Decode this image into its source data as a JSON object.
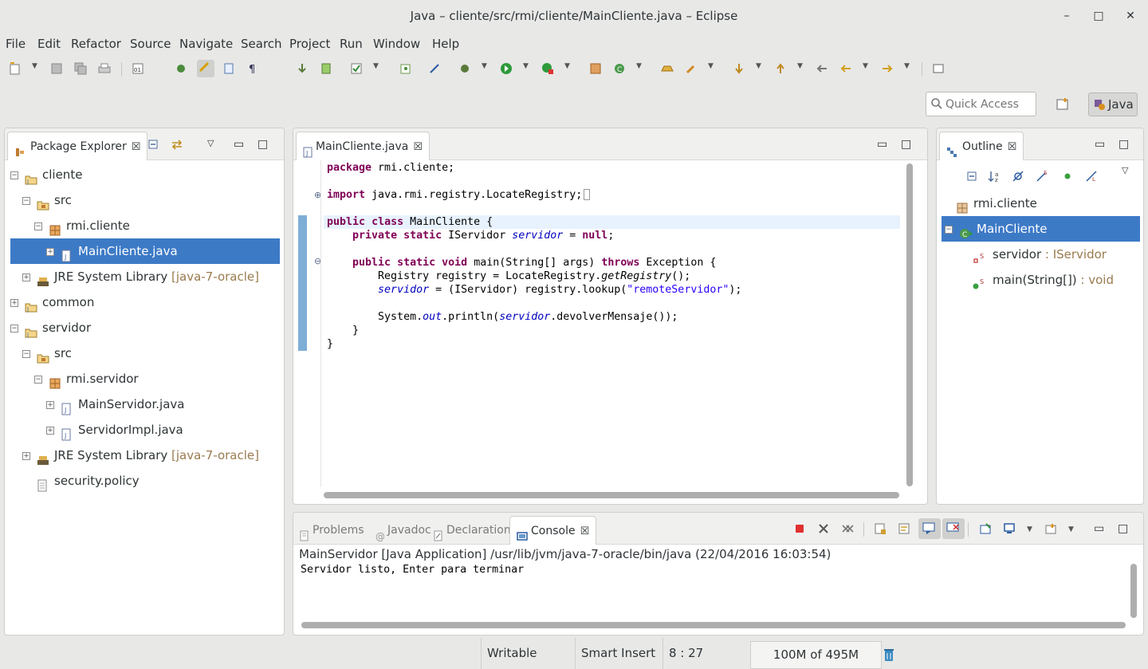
{
  "window": {
    "title": "Java – cliente/src/rmi/cliente/MainCliente.java – Eclipse",
    "minimize": "–",
    "maximize": "□",
    "close": "✕"
  },
  "menu": [
    "File",
    "Edit",
    "Refactor",
    "Source",
    "Navigate",
    "Search",
    "Project",
    "Run",
    "Window",
    "Help"
  ],
  "quick_access": {
    "placeholder": "Quick Access"
  },
  "perspective": {
    "label": "Java"
  },
  "package_explorer": {
    "title": "Package Explorer",
    "tree": [
      {
        "label": "cliente",
        "expander": "−"
      },
      {
        "label": "src",
        "expander": "−"
      },
      {
        "label": "rmi.cliente",
        "expander": "−"
      },
      {
        "label": "MainCliente.java",
        "expander": "+"
      },
      {
        "label": "JRE System Library",
        "decoration": "[java-7-oracle]",
        "expander": "+"
      },
      {
        "label": "common",
        "expander": "+"
      },
      {
        "label": "servidor",
        "expander": "−"
      },
      {
        "label": "src",
        "expander": "−"
      },
      {
        "label": "rmi.servidor",
        "expander": "−"
      },
      {
        "label": "MainServidor.java",
        "expander": "+"
      },
      {
        "label": "ServidorImpl.java",
        "expander": "+"
      },
      {
        "label": "JRE System Library",
        "decoration": "[java-7-oracle]",
        "expander": "+"
      },
      {
        "label": "security.policy"
      }
    ]
  },
  "editor": {
    "tab": "MainCliente.java",
    "code": {
      "l1": "package rmi.cliente;",
      "l2": "import java.rmi.registry.LocateRegistry;",
      "l3": "public class MainCliente {",
      "l4": "    private static IServidor servidor = null;",
      "l5": "    public static void main(String[] args) throws Exception {",
      "l6": "        Registry registry = LocateRegistry.getRegistry();",
      "l7": "        servidor = (IServidor) registry.lookup(\"remoteServidor\");",
      "l8": "        System.out.println(servidor.devolverMensaje());",
      "l9": "    }",
      "l10": "}"
    }
  },
  "outline": {
    "title": "Outline",
    "items": [
      {
        "label": "rmi.cliente"
      },
      {
        "label": "MainCliente",
        "expander": "−"
      },
      {
        "label": "servidor",
        "type": " : IServidor",
        "superscript": "S"
      },
      {
        "label": "main(String[])",
        "type": " : void",
        "superscript": "S"
      }
    ]
  },
  "bottom_tabs": [
    "Problems",
    "Javadoc",
    "Declaration",
    "Console"
  ],
  "console": {
    "header": "MainServidor [Java Application] /usr/lib/jvm/java-7-oracle/bin/java (22/04/2016 16:03:54)",
    "output": "Servidor listo, Enter para terminar"
  },
  "status": {
    "writable": "Writable",
    "insert_mode": "Smart Insert",
    "position": "8 : 27",
    "heap": "100M of 495M"
  },
  "colors": {
    "selection": "#3d7ac6",
    "keyword": "#7f0055",
    "field": "#0000c0",
    "string": "#2a00ff",
    "decoration": "#9a7b4f"
  }
}
